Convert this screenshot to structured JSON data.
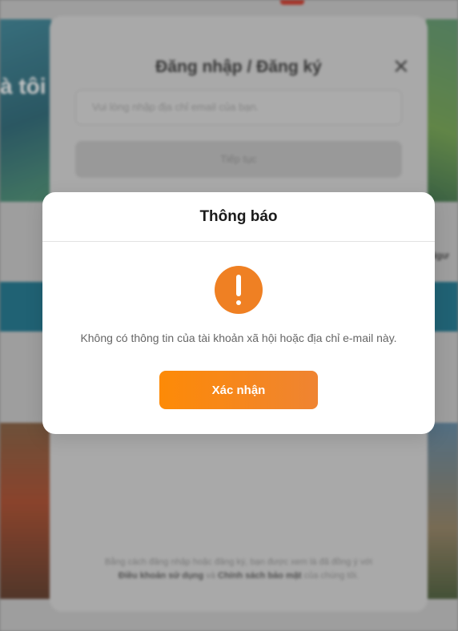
{
  "background": {
    "hero_text": "à tôi",
    "side_label_right": "Ngư",
    "login": {
      "title": "Đăng nhập / Đăng ký",
      "close_symbol": "✕",
      "email_placeholder": "Vui lòng nhập địa chỉ email của bạn.",
      "continue_label": "Tiếp tục",
      "terms_prefix": "Bằng cách đăng nhập hoặc đăng ký, bạn được xem là đã đồng ý với",
      "terms_link_1": "Điều khoản sử dụng",
      "terms_and": "và",
      "terms_link_2": "Chính sách bảo mật",
      "terms_suffix": "của chúng tôi."
    }
  },
  "dialog": {
    "title": "Thông báo",
    "icon": "exclamation-icon",
    "message": "Không có thông tin của tài khoản xã hội hoặc địa chỉ e-mail này.",
    "confirm_label": "Xác nhận"
  },
  "colors": {
    "accent": "#ef8023",
    "button_start": "#fd8a07",
    "button_end": "#ef8432"
  }
}
